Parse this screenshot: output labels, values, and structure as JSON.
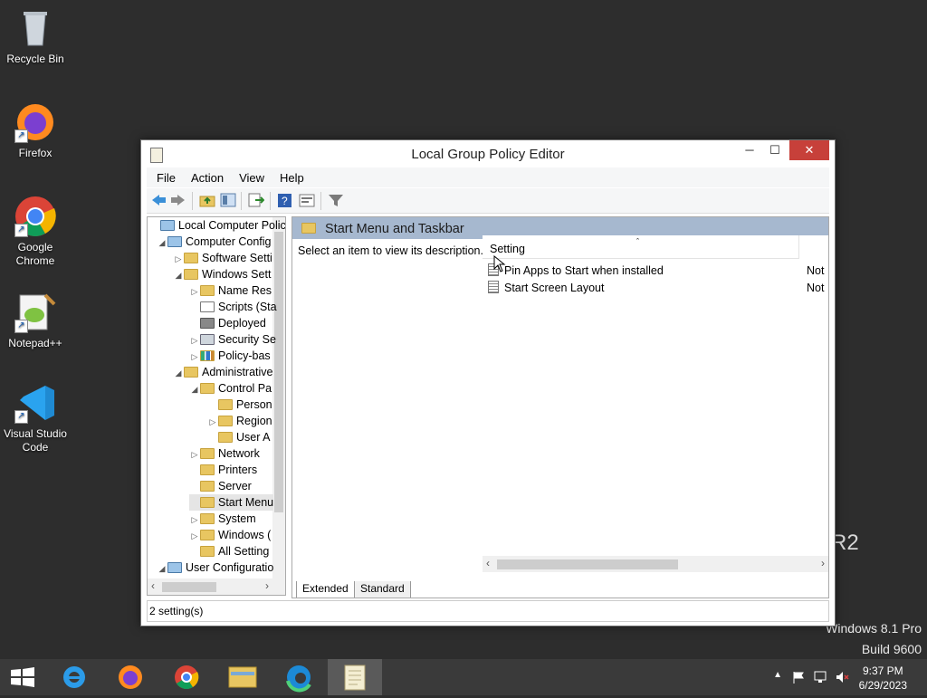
{
  "desktop": {
    "icons": [
      {
        "label": "Recycle Bin"
      },
      {
        "label": "Firefox"
      },
      {
        "label": "Google Chrome"
      },
      {
        "label": "Notepad++"
      },
      {
        "label": "Visual Studio Code"
      }
    ],
    "watermark": {
      "edition": "Windows 8.1 Pro",
      "build": "Build 9600",
      "fragment": "R2"
    }
  },
  "window": {
    "title": "Local Group Policy Editor",
    "menu": [
      "File",
      "Action",
      "View",
      "Help"
    ],
    "tree": [
      {
        "label": "Local Computer Polic",
        "exp": ""
      },
      {
        "label": "Computer Config",
        "exp": "◢"
      },
      {
        "label": "Software Setti",
        "exp": "▷"
      },
      {
        "label": "Windows Sett",
        "exp": "◢"
      },
      {
        "label": "Name Res",
        "exp": "▷"
      },
      {
        "label": "Scripts (Sta",
        "exp": ""
      },
      {
        "label": "Deployed",
        "exp": ""
      },
      {
        "label": "Security Se",
        "exp": "▷"
      },
      {
        "label": "Policy-bas",
        "exp": "▷"
      },
      {
        "label": "Administrative",
        "exp": "◢"
      },
      {
        "label": "Control Pa",
        "exp": "◢"
      },
      {
        "label": "Person",
        "exp": ""
      },
      {
        "label": "Region",
        "exp": "▷"
      },
      {
        "label": "User A",
        "exp": ""
      },
      {
        "label": "Network",
        "exp": "▷"
      },
      {
        "label": "Printers",
        "exp": ""
      },
      {
        "label": "Server",
        "exp": ""
      },
      {
        "label": "Start Menu",
        "exp": ""
      },
      {
        "label": "System",
        "exp": "▷"
      },
      {
        "label": "Windows (",
        "exp": "▷"
      },
      {
        "label": "All Setting",
        "exp": ""
      },
      {
        "label": "User Configuratio",
        "exp": "◢"
      }
    ],
    "pane_title": "Start Menu and Taskbar",
    "description": "Select an item to view its description.",
    "column_header": "Setting",
    "settings": [
      {
        "name": "Pin Apps to Start when installed",
        "state": "Not"
      },
      {
        "name": "Start Screen Layout",
        "state": "Not"
      }
    ],
    "tabs": [
      "Extended",
      "Standard"
    ],
    "status": "2 setting(s)"
  },
  "taskbar": {
    "time": "9:37 PM",
    "date": "6/29/2023"
  }
}
